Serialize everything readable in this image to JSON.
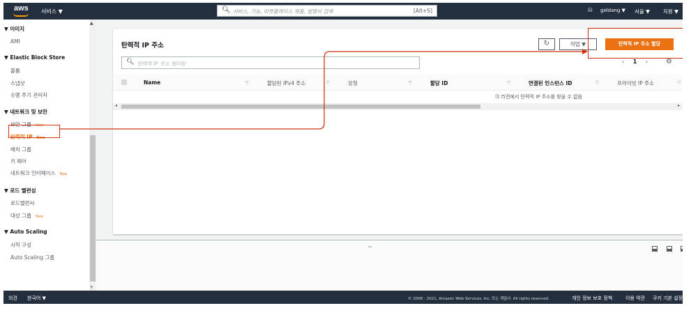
{
  "topnav": {
    "logo": "aws",
    "services": "서비스 ▼",
    "search_placeholder": "서비스, 기능, 마켓플레이스 제품, 설명서 검색",
    "search_shortcut": "[Alt+S]",
    "user": "goldang ▼",
    "region": "서울 ▼",
    "support": "지원 ▼"
  },
  "sidebar": {
    "items": [
      {
        "label": "▼ 이미지",
        "type": "head"
      },
      {
        "label": "AMI",
        "type": "item"
      },
      {
        "label": "▼ Elastic Block Store",
        "type": "head"
      },
      {
        "label": "볼륨",
        "type": "item"
      },
      {
        "label": "스냅샷",
        "type": "item"
      },
      {
        "label": "수명 주기 관리자",
        "type": "item"
      },
      {
        "label": "▼ 네트워크 및 보안",
        "type": "head"
      },
      {
        "label": "보안 그룹",
        "type": "item",
        "badge": "New"
      },
      {
        "label": "탄력적 IP",
        "type": "item",
        "badge": "New",
        "active": true
      },
      {
        "label": "배치 그룹",
        "type": "item"
      },
      {
        "label": "키 페어",
        "type": "item"
      },
      {
        "label": "네트워크 인터페이스",
        "type": "item",
        "badge": "New"
      },
      {
        "label": "▼ 로드 밸런싱",
        "type": "head"
      },
      {
        "label": "로드밸런서",
        "type": "item"
      },
      {
        "label": "대상 그룹",
        "type": "item",
        "badge": "New"
      },
      {
        "label": "▼ Auto Scaling",
        "type": "head"
      },
      {
        "label": "시작 구성",
        "type": "item"
      },
      {
        "label": "Auto Scaling 그룹",
        "type": "item"
      }
    ]
  },
  "panel": {
    "title": "탄력적 IP 주소",
    "action_label": "작업 ▼",
    "allocate_label": "탄력적 IP 주소 할당",
    "filter_placeholder": "탄력적 IP 주소 필터링",
    "page": "1",
    "columns": [
      "Name",
      "할당된 IPv4 주소",
      "유형",
      "할당 ID",
      "연결된 인스턴스 ID",
      "프라이빗 IP 주소"
    ],
    "empty_message": "이 리전에서 탄력적 IP 주소를 찾을 수 없음"
  },
  "footer": {
    "feedback": "의견",
    "language": "한국어 ▼",
    "copyright": "© 2008 - 2021, Amazon Web Services, Inc. 또는 계열사. All rights reserved.",
    "privacy": "개인 정보 보호 정책",
    "terms": "이용 약관",
    "cookies": "쿠키 기본 설정"
  },
  "colors": {
    "nav_bg": "#232f3e",
    "accent": "#ec7211",
    "annotation": "#d13212"
  }
}
